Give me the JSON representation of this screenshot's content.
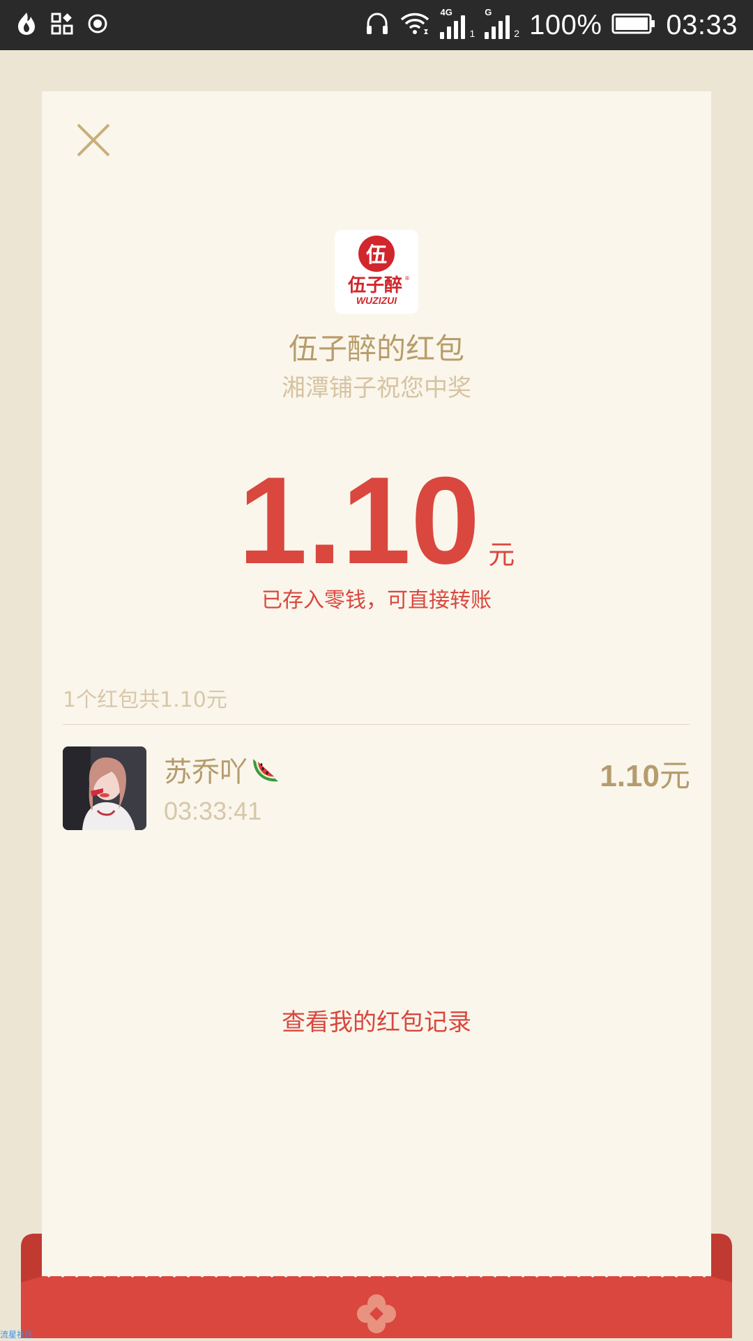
{
  "status_bar": {
    "battery_percent": "100%",
    "time": "03:33",
    "signal1_label": "4G",
    "signal1_sub": "1",
    "signal2_label": "G",
    "signal2_sub": "2",
    "icons": [
      "fire-icon",
      "apps-icon",
      "record-icon",
      "headphones-icon",
      "wifi-icon",
      "cellular-signal-icon",
      "battery-icon"
    ]
  },
  "packet": {
    "sender_title": "伍子醉的红包",
    "wish": "湘潭铺子祝您中奖",
    "amount": "1.10",
    "amount_unit": "元",
    "stored_note": "已存入零钱，可直接转账",
    "summary": "1个红包共1.10元",
    "logo_text": "伍子醉",
    "logo_subtext": "WUZIZUI",
    "logo_mark_text": "伍",
    "logo_registered": "®"
  },
  "records": [
    {
      "name": "苏乔吖",
      "time": "03:33:41",
      "amount": "1.10",
      "unit": "元"
    }
  ],
  "history_link": "查看我的红包记录",
  "watermark": "流星社区",
  "colors": {
    "accent_red": "#d9473e",
    "gold": "#b89c6a",
    "card_bg": "#faf6ec",
    "page_bg": "#ece5d4"
  }
}
